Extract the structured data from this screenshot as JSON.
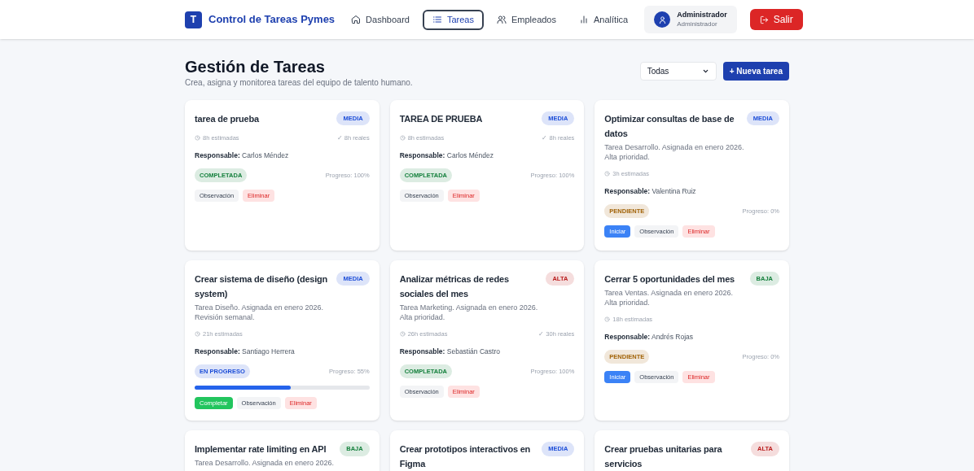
{
  "header": {
    "logo_letter": "T",
    "app_title": "Control de Tareas Pymes",
    "nav": [
      {
        "label": "Dashboard",
        "selected": false
      },
      {
        "label": "Tareas",
        "selected": true
      },
      {
        "label": "Empleados",
        "selected": false
      },
      {
        "label": "Analítica",
        "selected": false
      }
    ],
    "user": {
      "name": "Administrador",
      "role": "Administrador"
    },
    "logout": "Salir"
  },
  "page": {
    "title": "Gestión de Tareas",
    "subtitle": "Crea, asigna y monitorea tareas del equipo de talento humano.",
    "filter": "Todas",
    "new_button": "+ Nueva tarea"
  },
  "tasks": [
    {
      "title": "tarea de prueba",
      "priority": {
        "label": "MEDIA",
        "color": "#1d4ed8"
      },
      "estimated": "8h estimadas",
      "real": "✓ 8h reales",
      "responsible_label": "Responsable:",
      "responsible": "Carlos Méndez",
      "status": {
        "label": "COMPLETADA",
        "color": "#15803d"
      },
      "progress": "Progreso: 100%",
      "actions": [
        {
          "label": "Observación",
          "kind": "note"
        },
        {
          "label": "Eliminar",
          "kind": "delete"
        }
      ]
    },
    {
      "title": "TAREA DE PRUEBA",
      "priority": {
        "label": "MEDIA",
        "color": "#1d4ed8"
      },
      "estimated": "8h estimadas",
      "real": "✓ 8h reales",
      "responsible_label": "Responsable:",
      "responsible": "Carlos Méndez",
      "status": {
        "label": "COMPLETADA",
        "color": "#15803d"
      },
      "progress": "Progreso: 100%",
      "actions": [
        {
          "label": "Observación",
          "kind": "note"
        },
        {
          "label": "Eliminar",
          "kind": "delete"
        }
      ]
    },
    {
      "title": "Optimizar consultas de base de datos",
      "priority": {
        "label": "MEDIA",
        "color": "#1d4ed8"
      },
      "description": "Tarea Desarrollo. Asignada en enero 2026. Alta prioridad.",
      "estimated": "3h estimadas",
      "responsible_label": "Responsable:",
      "responsible": "Valentina Ruiz",
      "status": {
        "label": "PENDIENTE",
        "color": "#a16207"
      },
      "progress": "Progreso: 0%",
      "actions": [
        {
          "label": "Iniciar",
          "kind": "start"
        },
        {
          "label": "Observación",
          "kind": "note"
        },
        {
          "label": "Eliminar",
          "kind": "delete"
        }
      ]
    },
    {
      "title": "Crear sistema de diseño (design system)",
      "priority": {
        "label": "MEDIA",
        "color": "#1d4ed8"
      },
      "description": "Tarea Diseño. Asignada en enero 2026. Revisión semanal.",
      "estimated": "21h estimadas",
      "responsible_label": "Responsable:",
      "responsible": "Santiago Herrera",
      "status": {
        "label": "EN PROGRESO",
        "color": "#1d4ed8"
      },
      "progress": "Progreso: 55%",
      "level": 0.55,
      "actions": [
        {
          "label": "Completar",
          "kind": "complete"
        },
        {
          "label": "Observación",
          "kind": "note"
        },
        {
          "label": "Eliminar",
          "kind": "delete"
        }
      ]
    },
    {
      "title": "Analizar métricas de redes sociales del mes",
      "priority": {
        "label": "ALTA",
        "color": "#b91c1c"
      },
      "description": "Tarea Marketing. Asignada en enero 2026. Alta prioridad.",
      "estimated": "26h estimadas",
      "real": "✓ 30h reales",
      "responsible_label": "Responsable:",
      "responsible": "Sebastián Castro",
      "status": {
        "label": "COMPLETADA",
        "color": "#15803d"
      },
      "progress": "Progreso: 100%",
      "actions": [
        {
          "label": "Observación",
          "kind": "note"
        },
        {
          "label": "Eliminar",
          "kind": "delete"
        }
      ]
    },
    {
      "title": "Cerrar 5 oportunidades del mes",
      "priority": {
        "label": "BAJA",
        "color": "#15803d"
      },
      "description": "Tarea Ventas. Asignada en enero 2026. Alta prioridad.",
      "estimated": "18h estimadas",
      "responsible_label": "Responsable:",
      "responsible": "Andrés Rojas",
      "status": {
        "label": "PENDIENTE",
        "color": "#a16207"
      },
      "progress": "Progreso: 0%",
      "actions": [
        {
          "label": "Iniciar",
          "kind": "start"
        },
        {
          "label": "Observación",
          "kind": "note"
        },
        {
          "label": "Eliminar",
          "kind": "delete"
        }
      ]
    },
    {
      "title": "Implementar rate limiting en API",
      "priority": {
        "label": "BAJA",
        "color": "#15803d"
      },
      "description": "Tarea Desarrollo. Asignada en enero 2026."
    },
    {
      "title": "Crear prototipos interactivos en Figma",
      "priority": {
        "label": "MEDIA",
        "color": "#1d4ed8"
      }
    },
    {
      "title": "Crear pruebas unitarias para servicios",
      "priority": {
        "label": "ALTA",
        "color": "#b91c1c"
      }
    }
  ]
}
